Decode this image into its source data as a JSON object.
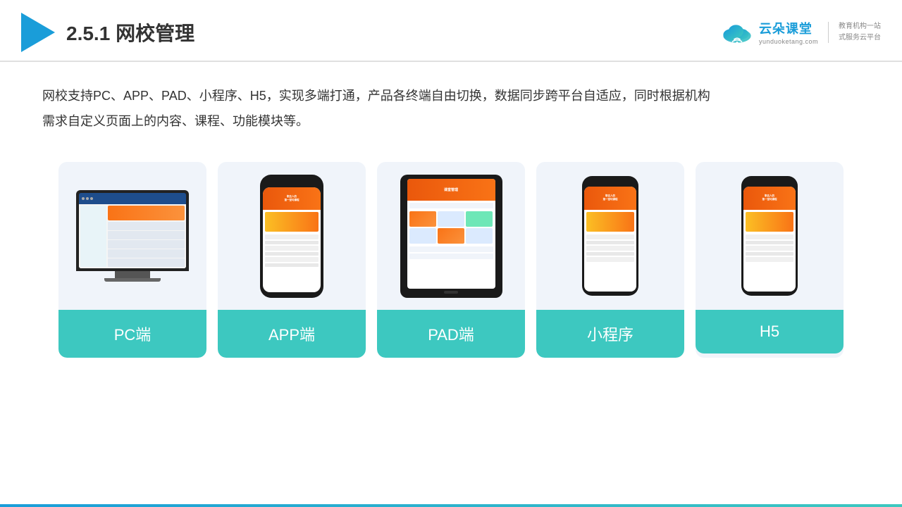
{
  "header": {
    "title": "网校管理",
    "section": "2.5.1",
    "brand_name": "云朵课堂",
    "brand_url": "yunduoketang.com",
    "brand_slogan": "教育机构一站\n式服务云平台"
  },
  "description": "网校支持PC、APP、PAD、小程序、H5，实现多端打通，产品各终端自由切换，数据同步跨平台自适应，同时根据机构\n需求自定义页面上的内容、课程、功能模块等。",
  "cards": [
    {
      "id": "pc",
      "label": "PC端"
    },
    {
      "id": "app",
      "label": "APP端"
    },
    {
      "id": "pad",
      "label": "PAD端"
    },
    {
      "id": "miniprogram",
      "label": "小程序"
    },
    {
      "id": "h5",
      "label": "H5"
    }
  ],
  "colors": {
    "accent_teal": "#3dc8c0",
    "accent_blue": "#1a9dd9",
    "card_bg": "#eef2fa"
  }
}
